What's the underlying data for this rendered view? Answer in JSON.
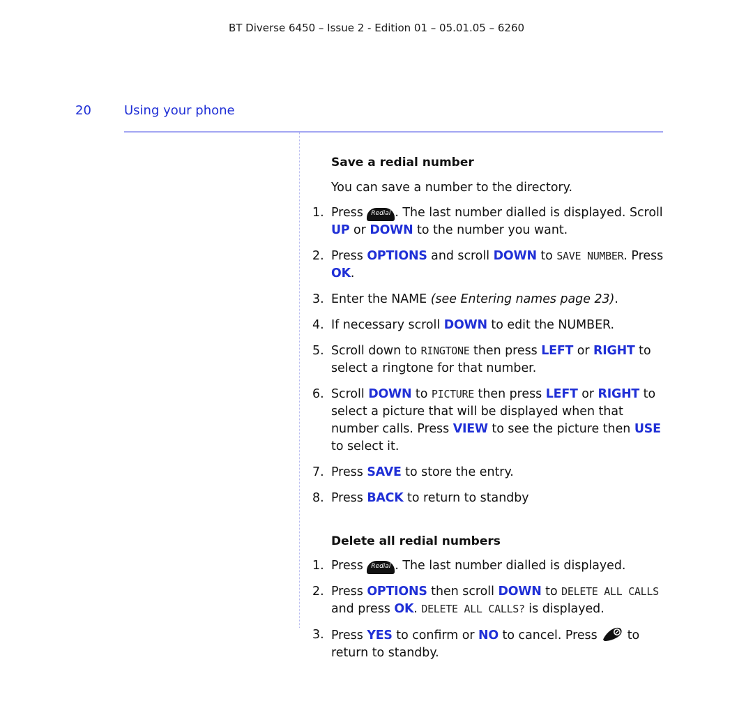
{
  "header": {
    "doc_id": "BT Diverse 6450 – Issue 2 - Edition 01 – 05.01.05 – 6260"
  },
  "page": {
    "number": "20",
    "section": "Using your phone"
  },
  "colors": {
    "accent": "#1f2fd6",
    "rule": "#a3a6f2"
  },
  "save": {
    "title": "Save a redial number",
    "intro": "You can save a number to the directory.",
    "steps": [
      {
        "n": "1.",
        "t1": "Press ",
        "key": "Redial",
        "t2": ". The last number dialled is displayed. Scroll ",
        "k1": "UP",
        "t3": " or ",
        "k2": "DOWN",
        "t4": " to the number you want."
      },
      {
        "n": "2.",
        "t1": "Press ",
        "k1": "OPTIONS",
        "t2": " and scroll ",
        "k2": "DOWN",
        "t3": " to ",
        "lcd": "SAVE NUMBER",
        "t4": ". Press ",
        "k3": "OK",
        "t5": "."
      },
      {
        "n": "3.",
        "t1": "Enter the NAME ",
        "ital": "(see Entering names page 23)",
        "t2": "."
      },
      {
        "n": "4.",
        "t1": "If necessary scroll ",
        "k1": "DOWN",
        "t2": " to edit the NUMBER."
      },
      {
        "n": "5.",
        "t1": "Scroll down to ",
        "lcd": "RINGTONE",
        "t2": " then press ",
        "k1": "LEFT",
        "t3": " or ",
        "k2": "RIGHT",
        "t4": " to select a ringtone for that number."
      },
      {
        "n": "6.",
        "t1": "Scroll ",
        "k1": "DOWN",
        "t2": " to ",
        "lcd": "PICTURE",
        "t3": " then press ",
        "k2": "LEFT",
        "t4": " or ",
        "k3": "RIGHT",
        "t5": " to select a picture that will be displayed when that number calls. Press ",
        "k4": "VIEW",
        "t6": " to see the picture then ",
        "k5": "USE",
        "t7": " to select it."
      },
      {
        "n": "7.",
        "t1": "Press ",
        "k1": "SAVE",
        "t2": " to store the entry."
      },
      {
        "n": "8.",
        "t1": "Press ",
        "k1": "BACK",
        "t2": " to return to standby"
      }
    ]
  },
  "delete": {
    "title": "Delete all redial numbers",
    "steps": [
      {
        "n": "1.",
        "t1": "Press ",
        "key": "Redial",
        "t2": ". The last number dialled is displayed."
      },
      {
        "n": "2.",
        "t1": "Press ",
        "k1": "OPTIONS",
        "t2": " then scroll ",
        "k2": "DOWN",
        "t3": " to ",
        "lcd": "DELETE ALL CALLS",
        "t4": " and press ",
        "k3": "OK",
        "t5": ". ",
        "lcd2": "DELETE ALL CALLS?",
        "t6": " is displayed."
      },
      {
        "n": "3.",
        "t1": "Press ",
        "k1": "YES",
        "t2": " to confirm or ",
        "k2": "NO",
        "t3": " to cancel. Press ",
        "t4": " to return to standby."
      }
    ]
  }
}
